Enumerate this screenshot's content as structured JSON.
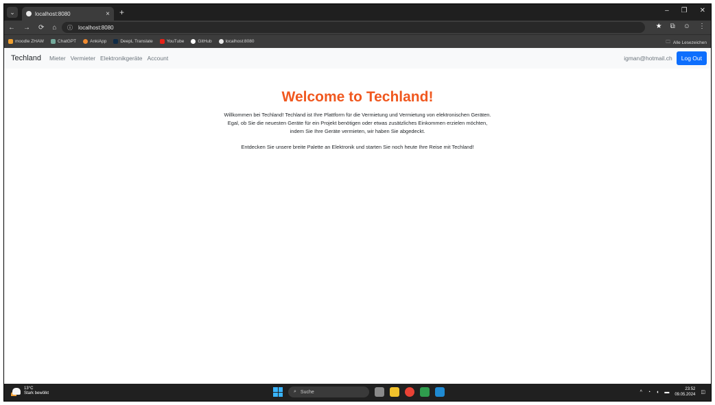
{
  "browser": {
    "tab_title": "localhost:8080",
    "address": "localhost:8080",
    "bookmarks": [
      "moodle ZHAW",
      "ChatGPT",
      "AnkiApp",
      "DeepL Translate",
      "YouTube",
      "GitHub",
      "localhost:8080"
    ],
    "all_bookmarks": "Alle Lesezeichen",
    "colors": {
      "chrome_dark": "#1f1f1f",
      "chrome_mid": "#3c3c3c"
    }
  },
  "navbar": {
    "brand": "Techland",
    "links": [
      "Mieter",
      "Vermieter",
      "Elektronikgeräte",
      "Account"
    ],
    "user_email": "igman@hotmail.ch",
    "logout_label": "Log Out",
    "colors": {
      "logout_bg": "#0d6efd"
    }
  },
  "main": {
    "title": "Welcome to Techland!",
    "paragraph_lines": [
      "Willkommen bei Techland! Techland ist Ihre Plattform für die Vermietung und Vermietung von elektronischen Geräten.",
      "Egal, ob Sie die neuesten Geräte für ein Projekt benötigen oder etwas zusätzliches Einkommen erzielen möchten,",
      "indem Sie Ihre Geräte vermieten, wir haben Sie abgedeckt."
    ],
    "paragraph2": "Entdecken Sie unsere breite Palette an Elektronik und starten Sie noch heute Ihre Reise mit Techland!",
    "colors": {
      "title": "#f0581f"
    }
  },
  "taskbar": {
    "weather_temp": "13°C",
    "weather_desc": "Stark bewölkt",
    "search_placeholder": "Suche",
    "time": "23:52",
    "date": "09.05.2024"
  }
}
